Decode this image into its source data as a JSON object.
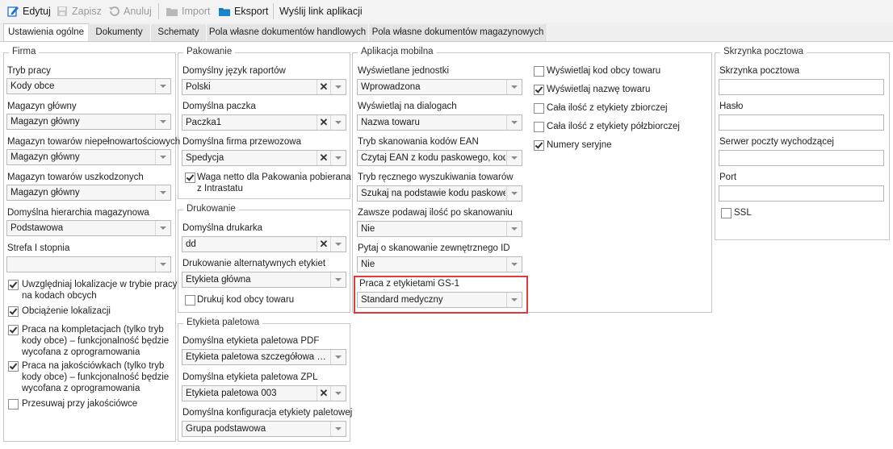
{
  "toolbar": {
    "edit": "Edytuj",
    "save": "Zapisz",
    "cancel": "Anuluj",
    "import": "Import",
    "export": "Eksport",
    "send_link": "Wyślij link aplikacji"
  },
  "tabs": [
    "Ustawienia ogólne",
    "Dokumenty",
    "Schematy",
    "Pola własne dokumentów handlowych",
    "Pola własne dokumentów magazynowych"
  ],
  "firma": {
    "title": "Firma",
    "tryb_pracy_label": "Tryb pracy",
    "tryb_pracy_value": "Kody obce",
    "mag_glowny_label": "Magazyn główny",
    "mag_glowny_value": "Magazyn główny",
    "mag_niepelnowart_label": "Magazyn towarów niepełnowartościowych",
    "mag_niepelnowart_value": "Magazyn główny",
    "mag_uszkodz_label": "Magazyn towarów uszkodzonych",
    "mag_uszkodz_value": "Magazyn główny",
    "hierarchia_label": "Domyślna hierarchia magazynowa",
    "hierarchia_value": "Podstawowa",
    "strefa_label": "Strefa I stopnia",
    "strefa_value": "",
    "check1_l1": "Uwzględniaj lokalizacje w trybie pracy",
    "check1_l2": "na kodach obcych",
    "check2": "Obciążenie lokalizacji",
    "check3_l1": "Praca na kompletacjach (tylko tryb",
    "check3_l2": "kody obce) – funkcjonalność będzie",
    "check3_l3": "wycofana z oprogramowania",
    "check4_l1": "Praca na jakościówkach (tylko tryb",
    "check4_l2": "kody obce) – funkcjonalność będzie",
    "check4_l3": "wycofana z oprogramowania",
    "check5": "Przesuwaj przy jakościówce"
  },
  "pakowanie": {
    "title": "Pakowanie",
    "jezyk_label": "Domyślny język raportów",
    "jezyk_value": "Polski",
    "paczka_label": "Domyślna paczka",
    "paczka_value": "Paczka1",
    "firma_label": "Domyślna firma przewozowa",
    "firma_value": "Spedycja",
    "waga_l1": "Waga netto dla Pakowania pobierana",
    "waga_l2": "z Intrastatu"
  },
  "drukowanie": {
    "title": "Drukowanie",
    "drukarka_label": "Domyślna drukarka",
    "drukarka_value": "dd",
    "alt_label": "Drukowanie alternatywnych etykiet",
    "alt_value": "Etykieta główna",
    "kod_obcy": "Drukuj kod obcy towaru"
  },
  "paletowa": {
    "title": "Etykieta paletowa",
    "pdf_label": "Domyślna etykieta paletowa PDF",
    "pdf_value": "Etykieta paletowa szczegółowa …",
    "zpl_label": "Domyślna etykieta paletowa ZPL",
    "zpl_value": "Etykieta paletowa 003",
    "konf_label": "Domyślna konfiguracja etykiety paletowej",
    "konf_value": "Grupa podstawowa"
  },
  "mobilna": {
    "title": "Aplikacja mobilna",
    "jednostki_label": "Wyświetlane jednostki",
    "jednostki_value": "Wprowadzona",
    "dialogi_label": "Wyświetlaj na dialogach",
    "dialogi_value": "Nazwa towaru",
    "ean_label": "Tryb skanowania kodów EAN",
    "ean_value": "Czytaj EAN z kodu paskowego, kod…",
    "reczne_label": "Tryb ręcznego wyszukiwania towarów",
    "reczne_value": "Szukaj na podstawie kodu paskowe…",
    "ilosc_label": "Zawsze podawaj ilość po skanowaniu",
    "ilosc_value": "Nie",
    "zewn_label": "Pytaj o skanowanie zewnętrznego ID",
    "zewn_value": "Nie",
    "gs1_label": "Praca z etykietami GS-1",
    "gs1_value": "Standard medyczny",
    "opt1": "Wyświetlaj kod obcy towaru",
    "opt2": "Wyświetlaj nazwę towaru",
    "opt3": "Cała ilość z etykiety zbiorczej",
    "opt4": "Cała ilość z etykiety półzbiorczej",
    "opt5": "Numery seryjne"
  },
  "skrzynka": {
    "title": "Skrzynka pocztowa",
    "skrzynka_label": "Skrzynka pocztowa",
    "haslo_label": "Hasło",
    "serwer_label": "Serwer poczty wychodzącej",
    "port_label": "Port",
    "ssl": "SSL"
  },
  "colors": {
    "highlight": "#e03a3a",
    "edit_icon": "#1e6fd9",
    "folder_icon": "#1577b8"
  }
}
